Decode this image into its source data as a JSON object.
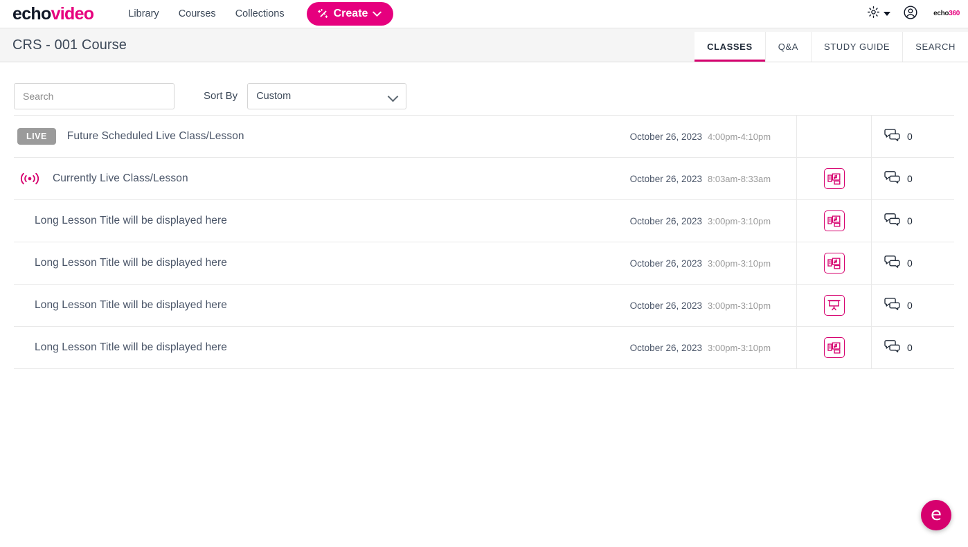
{
  "colors": {
    "brand_pink": "#e6007e",
    "accent_pink": "#d6006e",
    "text_dark": "#3c4858",
    "text_muted": "#9a9a9a",
    "live_badge_gray": "#9b9b9b",
    "titlebar_bg": "#f5f5f5"
  },
  "topnav": {
    "brand_echo": "echo",
    "brand_video": "video",
    "links": [
      {
        "label": "Library",
        "icon": ""
      },
      {
        "label": "Courses",
        "icon": ""
      },
      {
        "label": "Collections",
        "icon": ""
      }
    ],
    "create_label": "Create",
    "create_icon": "magic-wand-icon",
    "gear_icon": "gear-icon",
    "account_icon": "user-account-icon",
    "logo_echo": "echo",
    "logo_360": "360"
  },
  "titlebar": {
    "course_title": "CRS - 001 Course",
    "tabs": [
      {
        "label": "CLASSES",
        "active": true
      },
      {
        "label": "Q&A",
        "active": false
      },
      {
        "label": "STUDY GUIDE",
        "active": false
      },
      {
        "label": "SEARCH",
        "active": false
      }
    ]
  },
  "filters": {
    "search_value": "",
    "search_placeholder": "Search",
    "sort_by_label": "Sort By",
    "sort_value": "Custom",
    "sort_options": [
      "Custom"
    ]
  },
  "classes": [
    {
      "badge": "LIVE",
      "badge_type": "live-scheduled",
      "title": "Future Scheduled Live Class/Lesson",
      "date": "October 26, 2023",
      "time": "4:00pm-4:10pm",
      "media_icon": "",
      "comment_count": "0"
    },
    {
      "badge": "",
      "badge_type": "on-air",
      "title": "Currently Live Class/Lesson",
      "date": "October 26, 2023",
      "time": "8:03am-8:33am",
      "media_icon": "media-slides-icon",
      "comment_count": "0"
    },
    {
      "badge": "",
      "badge_type": "",
      "title": "Long Lesson Title will be displayed here",
      "date": "October 26, 2023",
      "time": "3:00pm-3:10pm",
      "media_icon": "media-slides-icon",
      "comment_count": "0"
    },
    {
      "badge": "",
      "badge_type": "",
      "title": "Long Lesson Title will be displayed here",
      "date": "October 26, 2023",
      "time": "3:00pm-3:10pm",
      "media_icon": "media-slides-icon",
      "comment_count": "0"
    },
    {
      "badge": "",
      "badge_type": "",
      "title": "Long Lesson Title will be displayed here",
      "date": "October 26, 2023",
      "time": "3:00pm-3:10pm",
      "media_icon": "presentation-icon",
      "comment_count": "0"
    },
    {
      "badge": "",
      "badge_type": "",
      "title": "Long Lesson Title will be displayed here",
      "date": "October 26, 2023",
      "time": "3:00pm-3:10pm",
      "media_icon": "media-slides-icon",
      "comment_count": "0"
    }
  ],
  "fab": {
    "label": "e",
    "icon": "echo-help-icon"
  }
}
